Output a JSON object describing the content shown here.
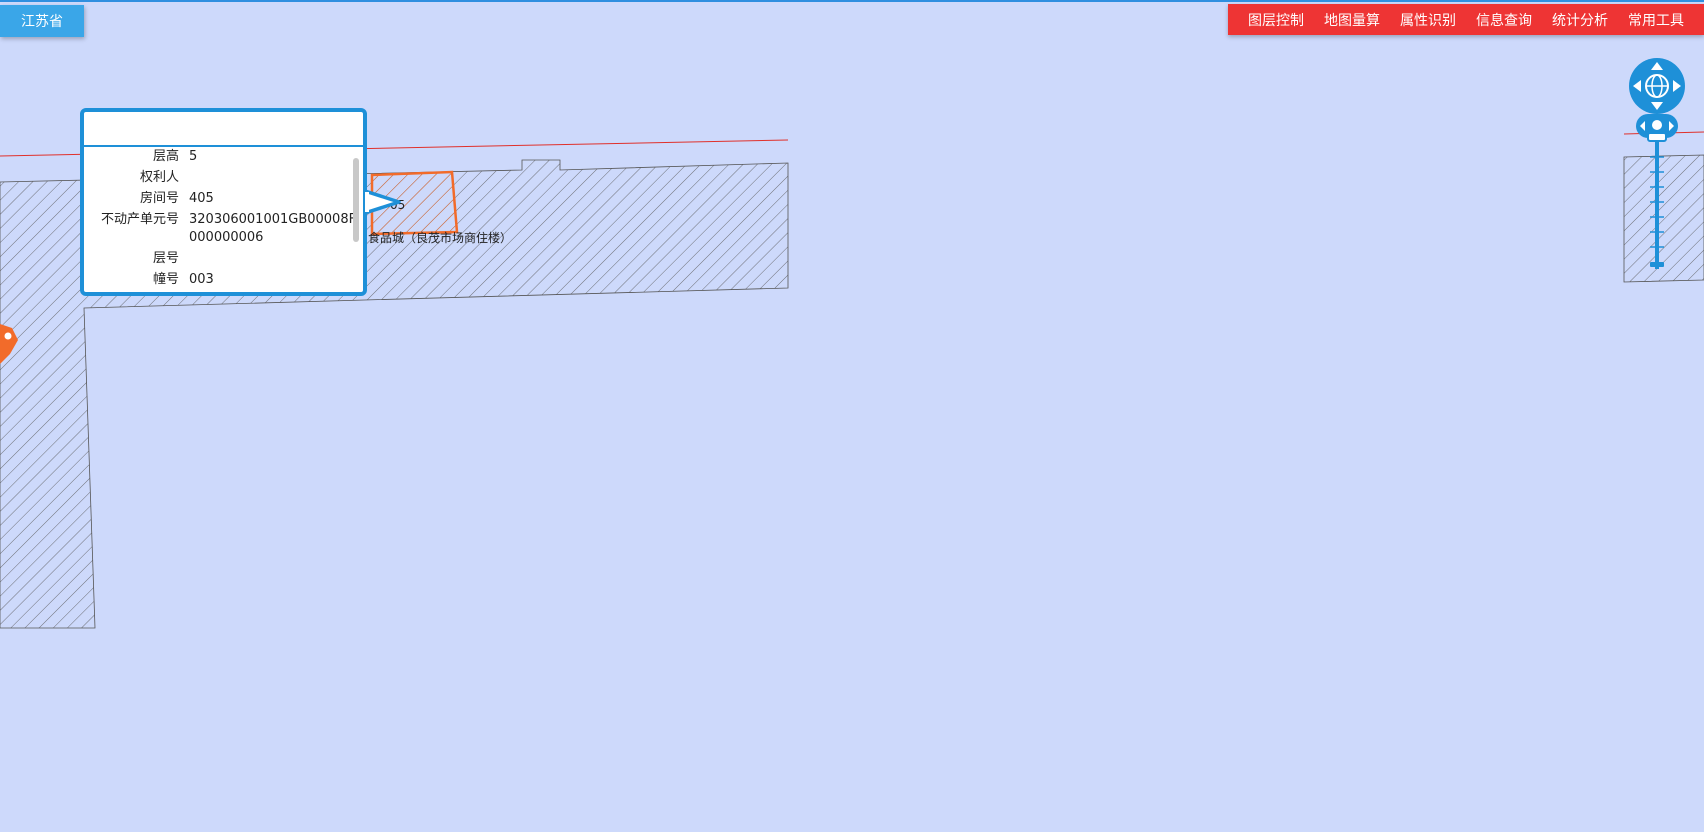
{
  "region": {
    "label": "江苏省"
  },
  "toolbar": {
    "items": [
      "图层控制",
      "地图量算",
      "属性识别",
      "信息查询",
      "统计分析",
      "常用工具"
    ]
  },
  "map": {
    "room_label_fragment": "05",
    "building_label_fragment": "食品城（良茂市场商住楼）"
  },
  "popup": {
    "rows": [
      {
        "key": "层高",
        "value": "5"
      },
      {
        "key": "权利人",
        "value": ""
      },
      {
        "key": "房间号",
        "value": "405"
      },
      {
        "key": "不动产单元号",
        "value": "320306001001GB00008F000000006"
      },
      {
        "key": "层号",
        "value": ""
      },
      {
        "key": "幢号",
        "value": "003"
      }
    ]
  },
  "colors": {
    "background": "#cdd9fb",
    "toolbar": "#ee3434",
    "region_button": "#3aa6e8",
    "popup_border": "#1e90d8",
    "highlight": "#f26b2a",
    "boundary_line": "#e0302a"
  },
  "icons": {
    "pan": "globe-pan-icon",
    "zoom_home": "zoom-home-icon"
  }
}
